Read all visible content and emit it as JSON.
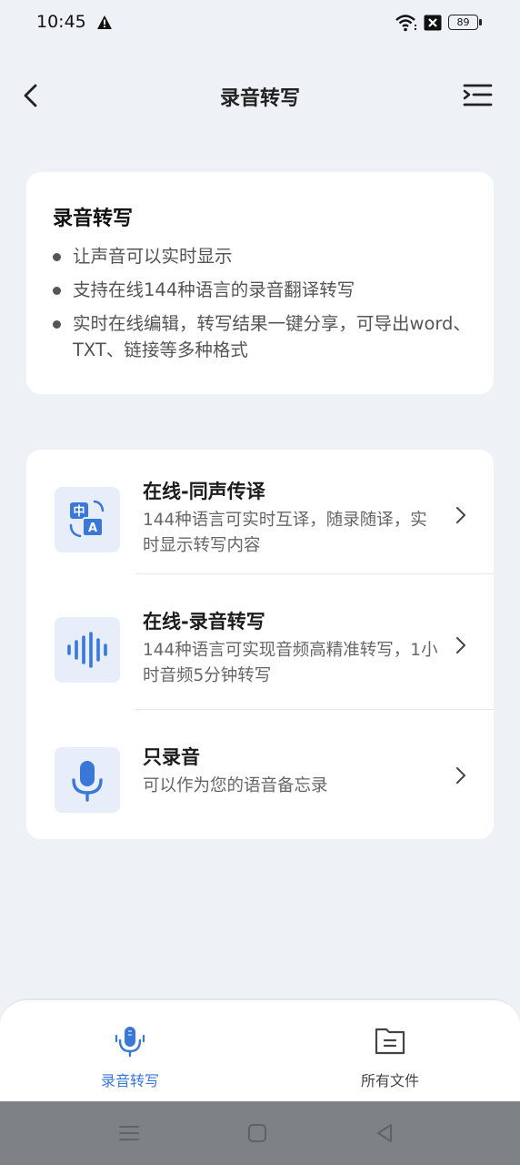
{
  "status_bar": {
    "time": "10:45",
    "battery": "89",
    "icons": [
      "warning-icon",
      "wifi-icon",
      "sim-off-icon",
      "battery-icon"
    ]
  },
  "header": {
    "title": "录音转写",
    "back_icon": "chevron-left-icon",
    "menu_icon": "list-menu-icon"
  },
  "intro": {
    "title": "录音转写",
    "bullets": [
      "让声音可以实时显示",
      "支持在线144种语言的录音翻译转写",
      "实时在线编辑，转写结果一键分享，可导出word、TXT、链接等多种格式"
    ]
  },
  "features": [
    {
      "icon": "translate-icon",
      "title": "在线-同声传译",
      "desc": "144种语言可实时互译，随录随译，实时显示转写内容"
    },
    {
      "icon": "waveform-icon",
      "title": "在线-录音转写",
      "desc": "144种语言可实现音频高精准转写，1小时音频5分钟转写"
    },
    {
      "icon": "microphone-icon",
      "title": "只录音",
      "desc": "可以作为您的语音备忘录"
    }
  ],
  "tabs": [
    {
      "label": "录音转写",
      "icon": "microphone-wave-icon",
      "active": true
    },
    {
      "label": "所有文件",
      "icon": "file-icon",
      "active": false
    }
  ],
  "colors": {
    "accent": "#3a78d8",
    "background": "#eef2f7",
    "card": "#ffffff",
    "icon_bg": "#e7eef9"
  }
}
